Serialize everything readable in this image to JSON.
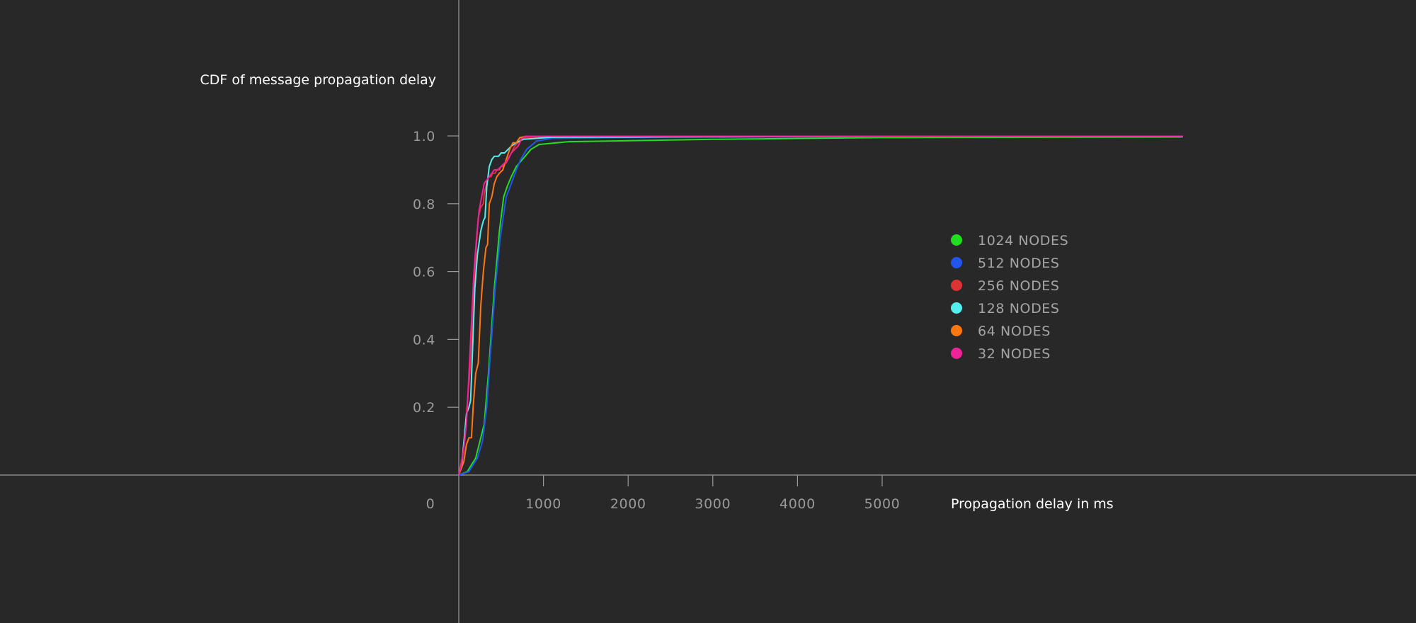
{
  "chart_data": {
    "type": "line",
    "ylabel": "CDF of message propagation delay",
    "xlabel": "Propagation delay in ms",
    "xlim": [
      0,
      8550
    ],
    "ylim": [
      0,
      1.0
    ],
    "x_ticks": [
      {
        "value": 0,
        "label": "0"
      },
      {
        "value": 1000,
        "label": "1000"
      },
      {
        "value": 2000,
        "label": "2000"
      },
      {
        "value": 3000,
        "label": "3000"
      },
      {
        "value": 4000,
        "label": "4000"
      },
      {
        "value": 5000,
        "label": "5000"
      }
    ],
    "y_ticks": [
      {
        "value": 0.2,
        "label": "0.2"
      },
      {
        "value": 0.4,
        "label": "0.4"
      },
      {
        "value": 0.6,
        "label": "0.6"
      },
      {
        "value": 0.8,
        "label": "0.8"
      },
      {
        "value": 1.0,
        "label": "1.0"
      }
    ],
    "grid": false,
    "legend_position": "right",
    "series": [
      {
        "name": "1024 NODES",
        "color": "#22dd22",
        "points": [
          [
            0,
            0
          ],
          [
            100,
            0.01
          ],
          [
            200,
            0.05
          ],
          [
            300,
            0.15
          ],
          [
            350,
            0.3
          ],
          [
            420,
            0.55
          ],
          [
            480,
            0.72
          ],
          [
            530,
            0.82
          ],
          [
            570,
            0.85
          ],
          [
            620,
            0.88
          ],
          [
            680,
            0.91
          ],
          [
            750,
            0.93
          ],
          [
            850,
            0.96
          ],
          [
            950,
            0.975
          ],
          [
            1300,
            0.983
          ],
          [
            3000,
            0.99
          ],
          [
            5000,
            0.995
          ],
          [
            8550,
            0.997
          ]
        ]
      },
      {
        "name": "512 NODES",
        "color": "#2255ee",
        "points": [
          [
            0,
            0
          ],
          [
            120,
            0.01
          ],
          [
            220,
            0.05
          ],
          [
            280,
            0.1
          ],
          [
            330,
            0.2
          ],
          [
            380,
            0.38
          ],
          [
            430,
            0.55
          ],
          [
            490,
            0.7
          ],
          [
            560,
            0.82
          ],
          [
            620,
            0.86
          ],
          [
            680,
            0.9
          ],
          [
            730,
            0.93
          ],
          [
            800,
            0.96
          ],
          [
            920,
            0.985
          ],
          [
            1100,
            0.993
          ],
          [
            2500,
            0.997
          ],
          [
            5000,
            0.998
          ],
          [
            8550,
            0.998
          ]
        ]
      },
      {
        "name": "256 NODES",
        "color": "#dd3333",
        "points": [
          [
            0,
            0
          ],
          [
            40,
            0.05
          ],
          [
            80,
            0.15
          ],
          [
            130,
            0.3
          ],
          [
            170,
            0.5
          ],
          [
            200,
            0.65
          ],
          [
            230,
            0.76
          ],
          [
            260,
            0.79
          ],
          [
            290,
            0.8
          ],
          [
            300,
            0.83
          ],
          [
            330,
            0.86
          ],
          [
            350,
            0.88
          ],
          [
            380,
            0.88
          ],
          [
            400,
            0.89
          ],
          [
            430,
            0.89
          ],
          [
            450,
            0.9
          ],
          [
            480,
            0.9
          ],
          [
            500,
            0.91
          ],
          [
            520,
            0.91
          ],
          [
            540,
            0.92
          ],
          [
            560,
            0.92
          ],
          [
            580,
            0.93
          ],
          [
            600,
            0.94
          ],
          [
            620,
            0.95
          ],
          [
            640,
            0.96
          ],
          [
            660,
            0.97
          ],
          [
            700,
            0.98
          ],
          [
            750,
            0.995
          ],
          [
            1000,
            0.998
          ],
          [
            5000,
            0.999
          ],
          [
            8550,
            0.999
          ]
        ]
      },
      {
        "name": "128 NODES",
        "color": "#55eeee",
        "points": [
          [
            0,
            0
          ],
          [
            40,
            0.04
          ],
          [
            90,
            0.18
          ],
          [
            120,
            0.2
          ],
          [
            140,
            0.22
          ],
          [
            160,
            0.35
          ],
          [
            190,
            0.55
          ],
          [
            220,
            0.65
          ],
          [
            260,
            0.72
          ],
          [
            290,
            0.75
          ],
          [
            310,
            0.76
          ],
          [
            330,
            0.85
          ],
          [
            360,
            0.91
          ],
          [
            390,
            0.93
          ],
          [
            420,
            0.94
          ],
          [
            470,
            0.94
          ],
          [
            500,
            0.95
          ],
          [
            540,
            0.95
          ],
          [
            580,
            0.96
          ],
          [
            620,
            0.97
          ],
          [
            680,
            0.98
          ],
          [
            760,
            0.99
          ],
          [
            1100,
            0.996
          ],
          [
            5000,
            0.999
          ],
          [
            8550,
            0.998
          ]
        ]
      },
      {
        "name": "64 NODES",
        "color": "#ff7711",
        "points": [
          [
            0,
            0
          ],
          [
            60,
            0.04
          ],
          [
            90,
            0.09
          ],
          [
            120,
            0.11
          ],
          [
            150,
            0.11
          ],
          [
            170,
            0.2
          ],
          [
            200,
            0.3
          ],
          [
            230,
            0.33
          ],
          [
            260,
            0.5
          ],
          [
            290,
            0.6
          ],
          [
            320,
            0.67
          ],
          [
            340,
            0.68
          ],
          [
            360,
            0.8
          ],
          [
            390,
            0.82
          ],
          [
            420,
            0.86
          ],
          [
            450,
            0.88
          ],
          [
            480,
            0.89
          ],
          [
            520,
            0.9
          ],
          [
            560,
            0.93
          ],
          [
            600,
            0.96
          ],
          [
            640,
            0.98
          ],
          [
            680,
            0.98
          ],
          [
            720,
            0.995
          ],
          [
            800,
            0.999
          ],
          [
            5000,
            0.999
          ],
          [
            8550,
            0.999
          ]
        ]
      },
      {
        "name": "32 NODES",
        "color": "#ee2299",
        "points": [
          [
            0,
            0
          ],
          [
            30,
            0.03
          ],
          [
            60,
            0.08
          ],
          [
            90,
            0.15
          ],
          [
            120,
            0.3
          ],
          [
            150,
            0.45
          ],
          [
            180,
            0.6
          ],
          [
            210,
            0.7
          ],
          [
            240,
            0.78
          ],
          [
            270,
            0.82
          ],
          [
            300,
            0.86
          ],
          [
            330,
            0.87
          ],
          [
            360,
            0.88
          ],
          [
            390,
            0.89
          ],
          [
            420,
            0.9
          ],
          [
            460,
            0.9
          ],
          [
            500,
            0.91
          ],
          [
            540,
            0.92
          ],
          [
            580,
            0.93
          ],
          [
            620,
            0.95
          ],
          [
            660,
            0.96
          ],
          [
            700,
            0.97
          ],
          [
            740,
            0.99
          ],
          [
            780,
            0.999
          ],
          [
            5000,
            0.999
          ],
          [
            8550,
            0.999
          ]
        ]
      }
    ]
  }
}
